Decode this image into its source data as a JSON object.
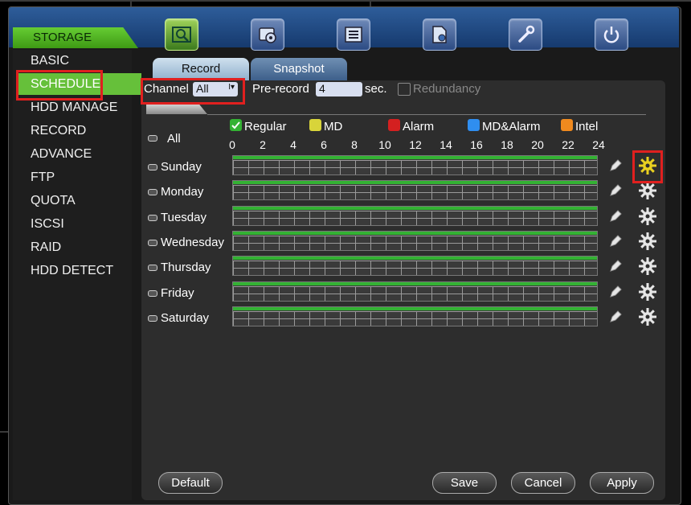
{
  "topbar": {
    "icons": [
      "search-icon",
      "storage-icon",
      "list-icon",
      "settings-doc-icon",
      "wrench-icon",
      "power-icon"
    ]
  },
  "section": {
    "title": "STORAGE"
  },
  "sidebar": {
    "items": [
      {
        "label": "BASIC"
      },
      {
        "label": "SCHEDULE"
      },
      {
        "label": "HDD MANAGE"
      },
      {
        "label": "RECORD"
      },
      {
        "label": "ADVANCE"
      },
      {
        "label": "FTP"
      },
      {
        "label": "QUOTA"
      },
      {
        "label": "ISCSI"
      },
      {
        "label": "RAID"
      },
      {
        "label": "HDD DETECT"
      }
    ],
    "selected": "SCHEDULE"
  },
  "tabs": [
    {
      "label": "Record"
    },
    {
      "label": "Snapshot"
    }
  ],
  "controls": {
    "channel_label": "Channel",
    "channel_value": "All",
    "prerecord_label": "Pre-record",
    "prerecord_value": "4",
    "sec_label": "sec.",
    "redundancy_label": "Redundancy"
  },
  "legend": [
    {
      "label": "Regular",
      "color": "#33b233",
      "checked": true
    },
    {
      "label": "MD",
      "color": "#d8d43a",
      "checked": false
    },
    {
      "label": "Alarm",
      "color": "#d42020",
      "checked": false
    },
    {
      "label": "MD&Alarm",
      "color": "#2f8ef0",
      "checked": false
    },
    {
      "label": "Intel",
      "color": "#f08a1e",
      "checked": false
    }
  ],
  "schedule": {
    "all_label": "All",
    "hours": [
      "0",
      "2",
      "4",
      "6",
      "8",
      "10",
      "12",
      "14",
      "16",
      "18",
      "20",
      "22",
      "24"
    ],
    "days": [
      {
        "label": "Sunday"
      },
      {
        "label": "Monday"
      },
      {
        "label": "Tuesday"
      },
      {
        "label": "Wednesday"
      },
      {
        "label": "Thursday"
      },
      {
        "label": "Friday"
      },
      {
        "label": "Saturday"
      }
    ],
    "regular_coverage": 1.0
  },
  "buttons": {
    "default": "Default",
    "save": "Save",
    "cancel": "Cancel",
    "apply": "Apply"
  }
}
